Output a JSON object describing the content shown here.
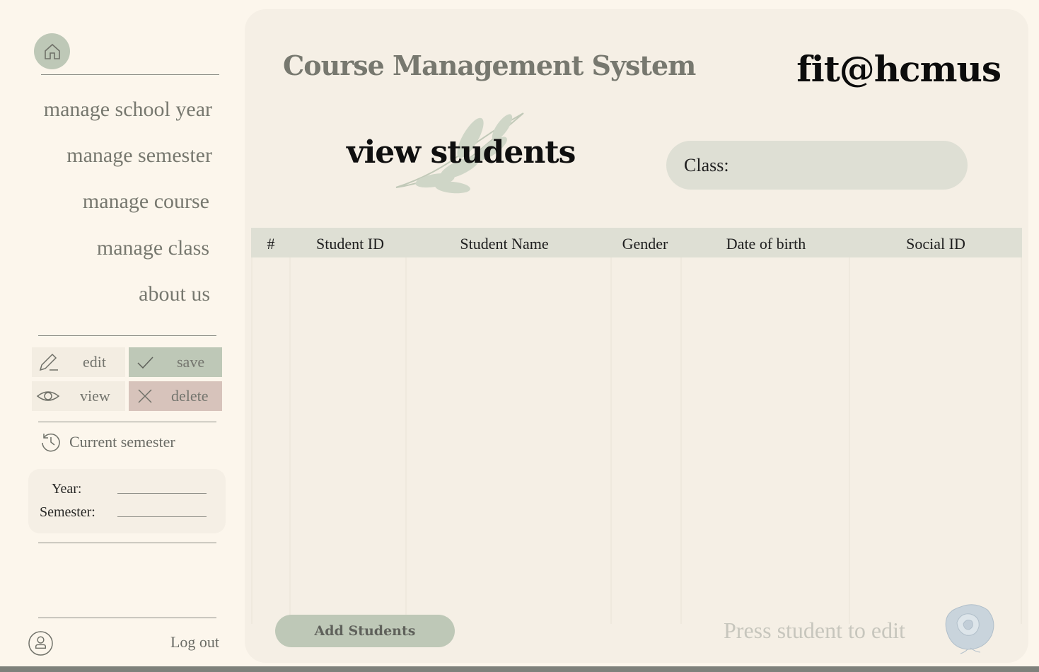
{
  "sidebar": {
    "nav": [
      {
        "label": "manage school year"
      },
      {
        "label": "manage semester"
      },
      {
        "label": "manage course"
      },
      {
        "label": "manage class"
      },
      {
        "label": "about us"
      }
    ],
    "actions": {
      "edit": "edit",
      "save": "save",
      "view": "view",
      "delete": "delete"
    },
    "current_semester": {
      "title": "Current semester",
      "year_label": "Year:",
      "semester_label": "Semester:"
    },
    "logout": "Log out"
  },
  "header": {
    "app_title": "Course Management System",
    "brand": "fit@hcmus"
  },
  "page": {
    "title": "view students",
    "class_filter": {
      "label": "Class:",
      "value": ""
    }
  },
  "table": {
    "columns": [
      "#",
      "Student ID",
      "Student Name",
      "Gender",
      "Date of birth",
      "Social ID"
    ],
    "rows": []
  },
  "footer": {
    "add_button": "Add Students",
    "hint": "Press student to edit"
  },
  "colors": {
    "background": "#fcf6ec",
    "panel": "#f5efe5",
    "sage": "#bec8b7",
    "delete": "#d7c3bb",
    "header_row": "#dedfd4"
  }
}
